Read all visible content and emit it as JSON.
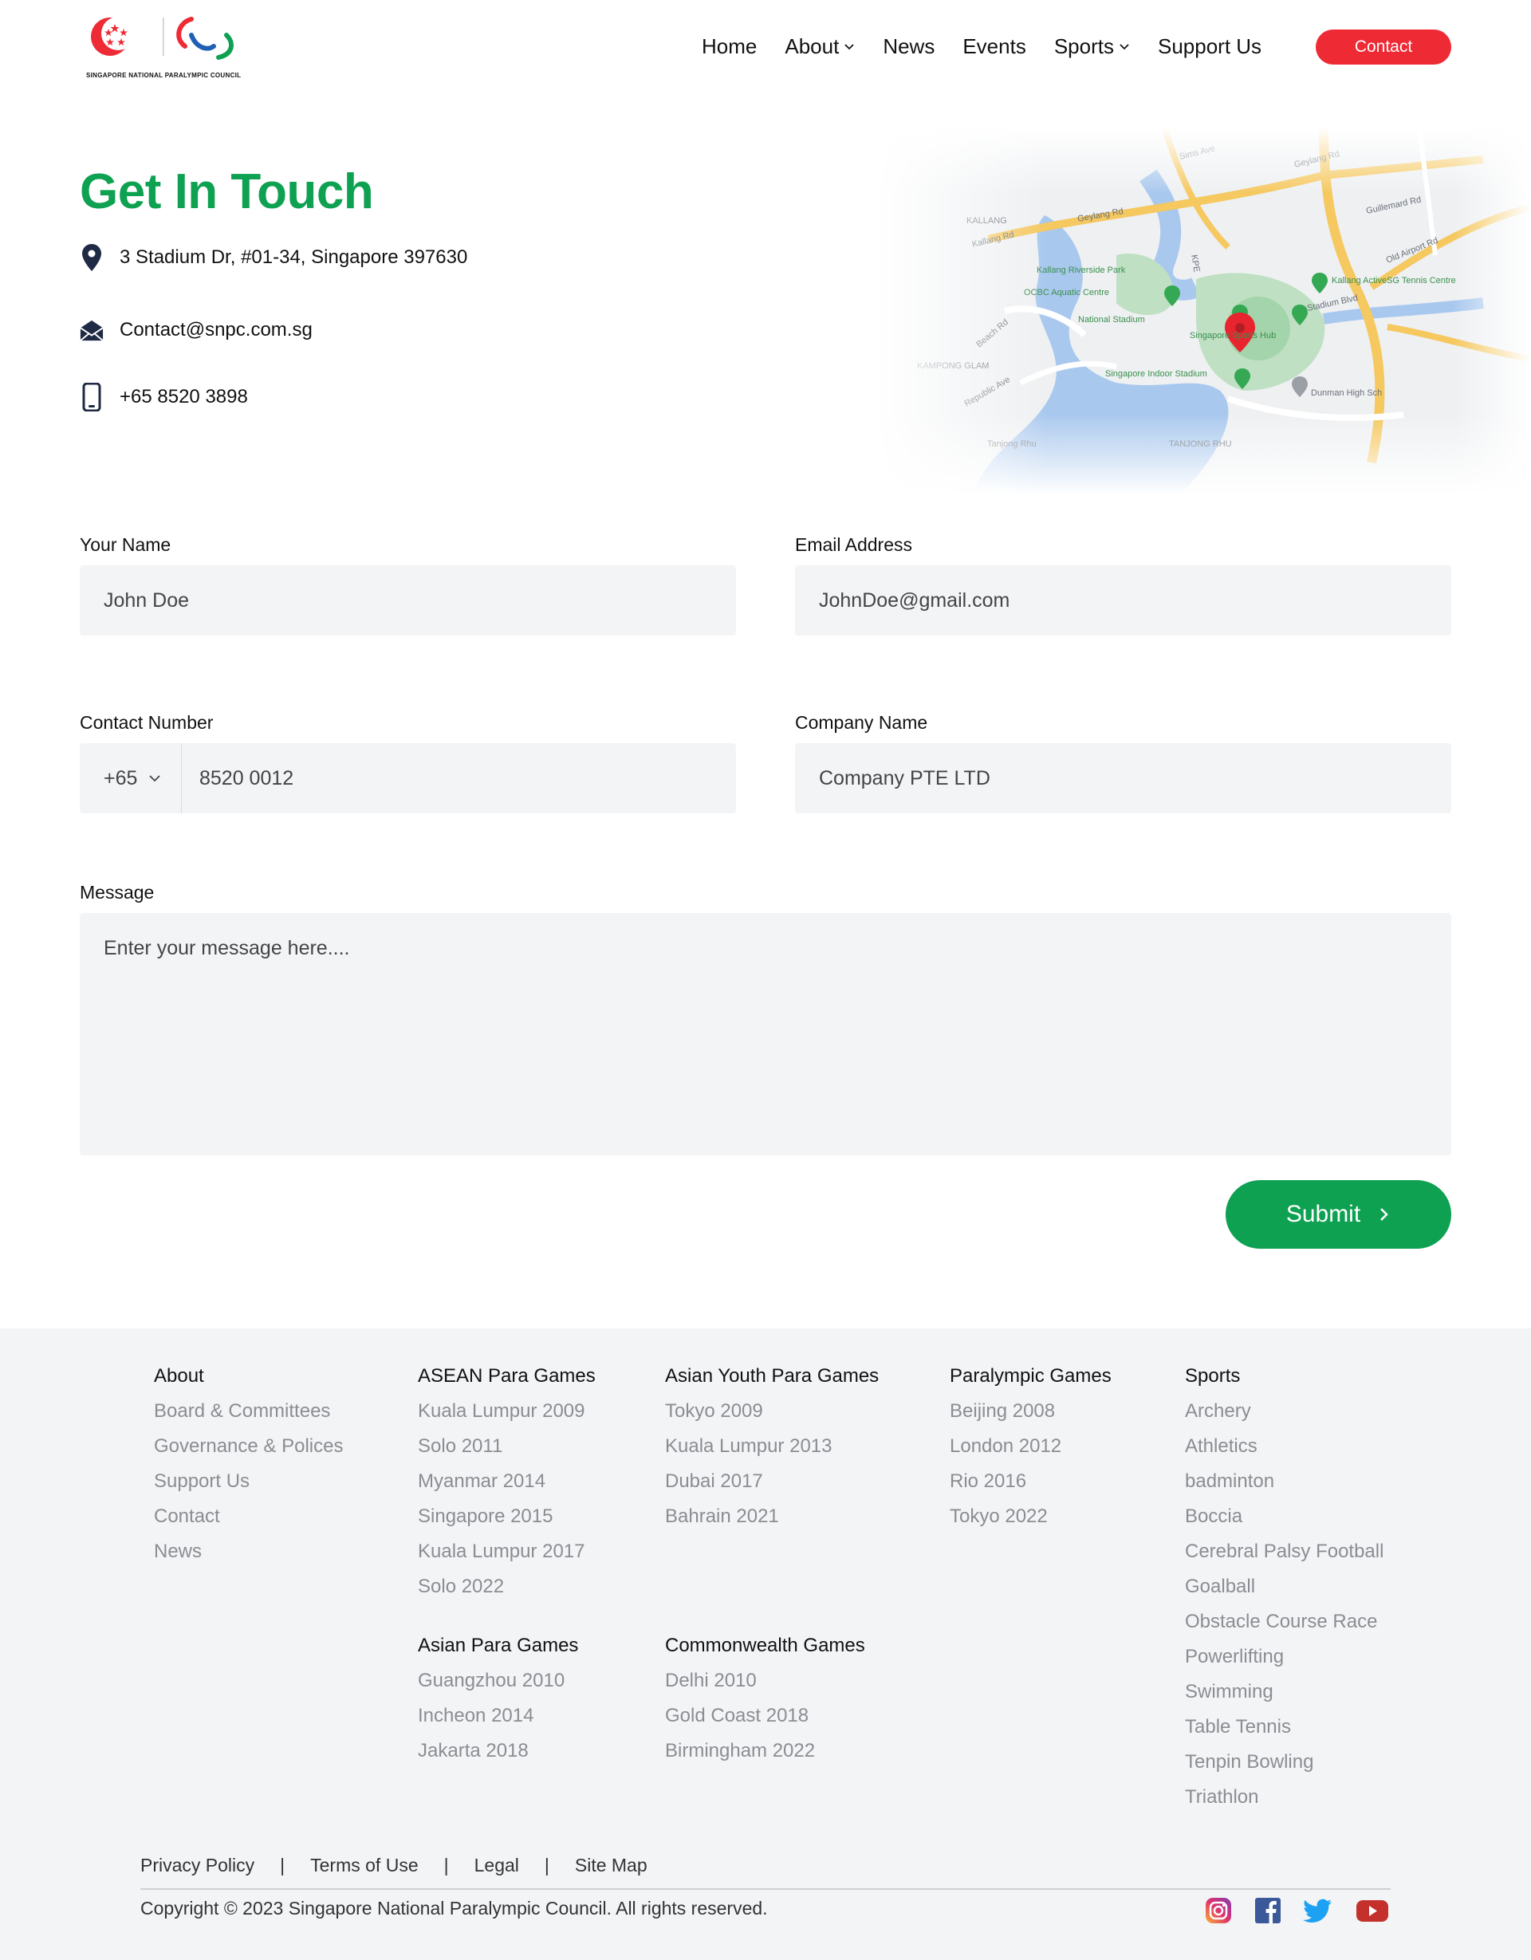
{
  "header": {
    "logo_caption": "SINGAPORE NATIONAL PARALYMPIC COUNCIL",
    "nav": [
      {
        "label": "Home",
        "has_dropdown": false
      },
      {
        "label": "About",
        "has_dropdown": true
      },
      {
        "label": "News",
        "has_dropdown": false
      },
      {
        "label": "Events",
        "has_dropdown": false
      },
      {
        "label": "Sports",
        "has_dropdown": true
      },
      {
        "label": "Support Us",
        "has_dropdown": false
      }
    ],
    "contact_button": "Contact"
  },
  "contact": {
    "title": "Get In Touch",
    "address": "3 Stadium Dr, #01-34, Singapore 397630",
    "email": "Contact@snpc.com.sg",
    "phone": "+65 8520 3898"
  },
  "map": {
    "labels": [
      "KALLANG",
      "Kallang Rd",
      "Geylang Rd",
      "Kallang Riverside Park",
      "OCBC Aquatic Centre",
      "National Stadium",
      "Kallang ActiveSG Tennis Centre",
      "Singapore Sports Hub",
      "Singapore Indoor Stadium",
      "Beach Rd",
      "Republic Ave",
      "KAMPONG GLAM",
      "Tanjong Rhu",
      "TANJONG RHU",
      "Dunman High Sch",
      "KPE",
      "Guillemard Rd",
      "Sims Ave",
      "Geylang Rd",
      "Old Airport Rd",
      "Stadium Blvd"
    ]
  },
  "form": {
    "name_label": "Your Name",
    "name_value": "John Doe",
    "email_label": "Email Address",
    "email_value": "JohnDoe@gmail.com",
    "contact_label": "Contact Number",
    "country_code": "+65",
    "contact_value": "8520 0012",
    "company_label": "Company Name",
    "company_value": "Company PTE LTD",
    "message_label": "Message",
    "message_placeholder": "Enter your message here....",
    "submit_label": "Submit"
  },
  "footer": {
    "columns": [
      {
        "heading": "About",
        "links": [
          "Board & Committees",
          "Governance & Polices",
          "Support Us",
          "Contact",
          "News"
        ]
      },
      {
        "heading": "ASEAN Para Games",
        "links": [
          "Kuala Lumpur 2009",
          "Solo 2011",
          "Myanmar 2014",
          "Singapore 2015",
          "Kuala Lumpur 2017",
          "Solo 2022"
        ]
      },
      {
        "heading": "Asian Para Games",
        "links": [
          "Guangzhou 2010",
          "Incheon 2014",
          "Jakarta 2018"
        ]
      },
      {
        "heading": "Asian Youth Para Games",
        "links": [
          "Tokyo 2009",
          "Kuala Lumpur 2013",
          "Dubai 2017",
          "Bahrain 2021"
        ]
      },
      {
        "heading": "Commonwealth Games",
        "links": [
          "Delhi 2010",
          "Gold Coast 2018",
          "Birmingham 2022"
        ]
      },
      {
        "heading": "Paralympic Games",
        "links": [
          "Beijing 2008",
          "London 2012",
          "Rio 2016",
          "Tokyo 2022"
        ]
      },
      {
        "heading": "Sports",
        "links": [
          "Archery",
          "Athletics",
          "badminton",
          "Boccia",
          "Cerebral Palsy Football",
          "Goalball",
          "Obstacle Course Race",
          "Powerlifting",
          "Swimming",
          "Table Tennis",
          "Tenpin Bowling",
          "Triathlon"
        ]
      }
    ],
    "legal_links": [
      "Privacy Policy",
      "Terms of Use",
      "Legal",
      "Site Map"
    ],
    "separator": "|",
    "copyright": "Copyright © 2023 Singapore National Paralympic Council. All rights reserved.",
    "social": [
      "instagram-icon",
      "facebook-icon",
      "twitter-icon",
      "youtube-icon"
    ]
  },
  "colors": {
    "brand_green": "#0ea152",
    "brand_red": "#ee2a35",
    "field_bg": "#f3f4f6",
    "footer_bg": "#f3f4f6",
    "link_grey": "#8a8d92",
    "icon_navy": "#1f2a44"
  }
}
